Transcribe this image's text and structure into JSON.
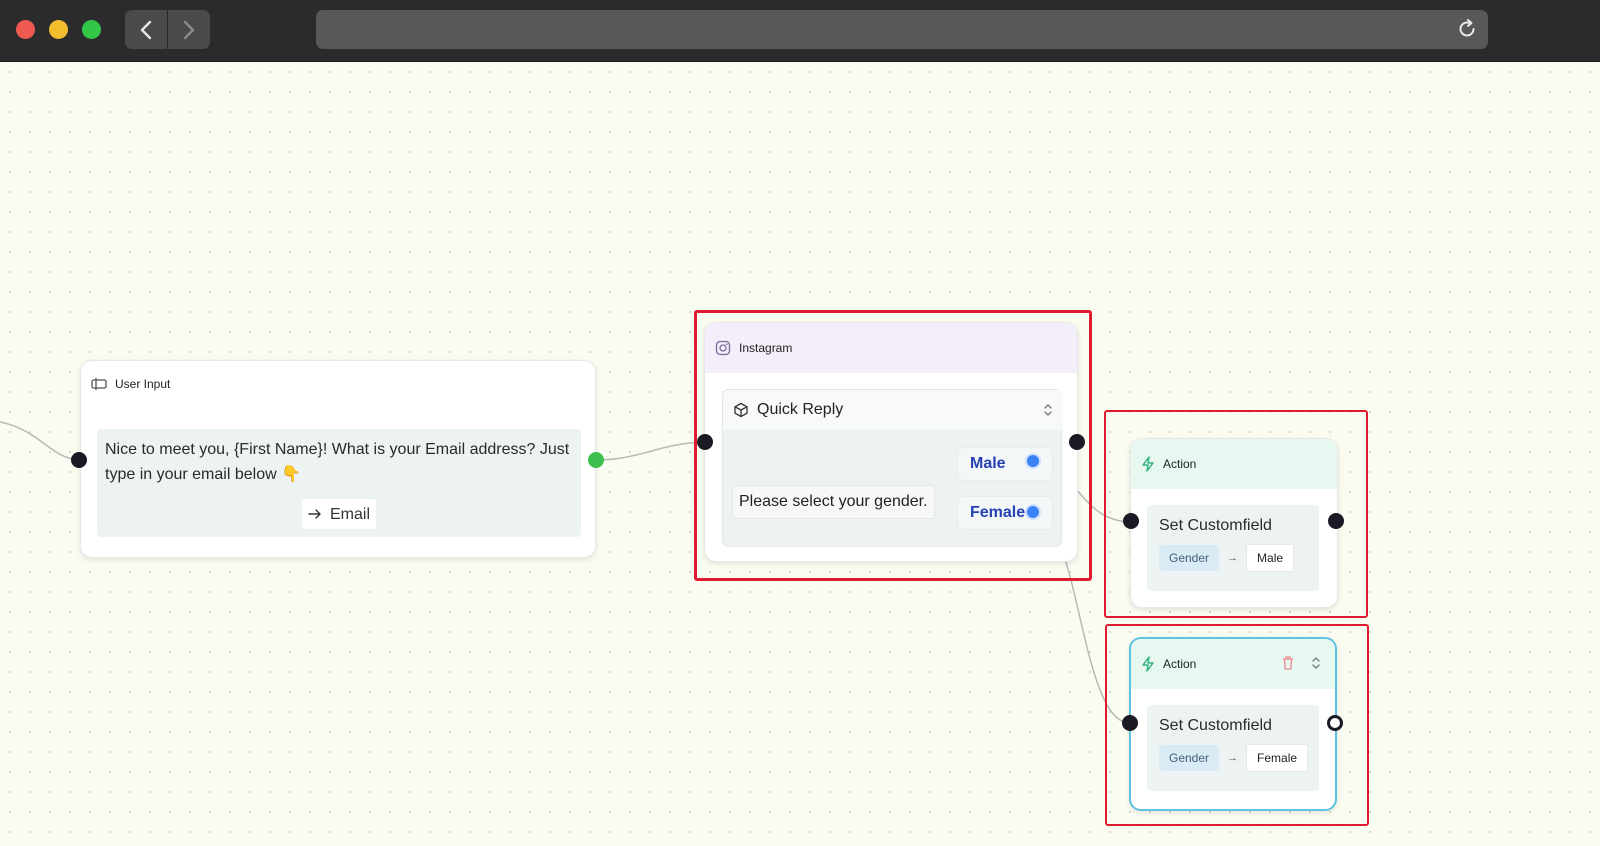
{
  "browser": {
    "window_controls": [
      "close",
      "minimize",
      "zoom"
    ],
    "back_icon": "chevron-left-icon",
    "forward_icon": "chevron-right-icon",
    "reload_icon": "reload-icon"
  },
  "user_input_node": {
    "title": "User Input",
    "icon": "user-input-icon",
    "message": "Nice to meet you, {First Name}! What is your Email address? Just type in your email below 👇",
    "response_label": "Email"
  },
  "instagram_node": {
    "title": "Instagram",
    "icon": "instagram-icon",
    "block_title": "Quick Reply",
    "block_icon": "cube-icon",
    "prompt": "Please select your gender.",
    "options": [
      "Male",
      "Female"
    ]
  },
  "action_nodes": [
    {
      "title": "Action",
      "icon": "lightning-icon",
      "action_title": "Set Customfield",
      "field": "Gender",
      "value": "Male"
    },
    {
      "title": "Action",
      "icon": "lightning-icon",
      "action_title": "Set Customfield",
      "field": "Gender",
      "value": "Female"
    }
  ],
  "colors": {
    "highlight": "#e01b2f",
    "option_text": "#2541b2",
    "option_handle": "#3b82f6",
    "connected_handle": "#3fbf4f",
    "selected_border": "#5fc3df"
  }
}
